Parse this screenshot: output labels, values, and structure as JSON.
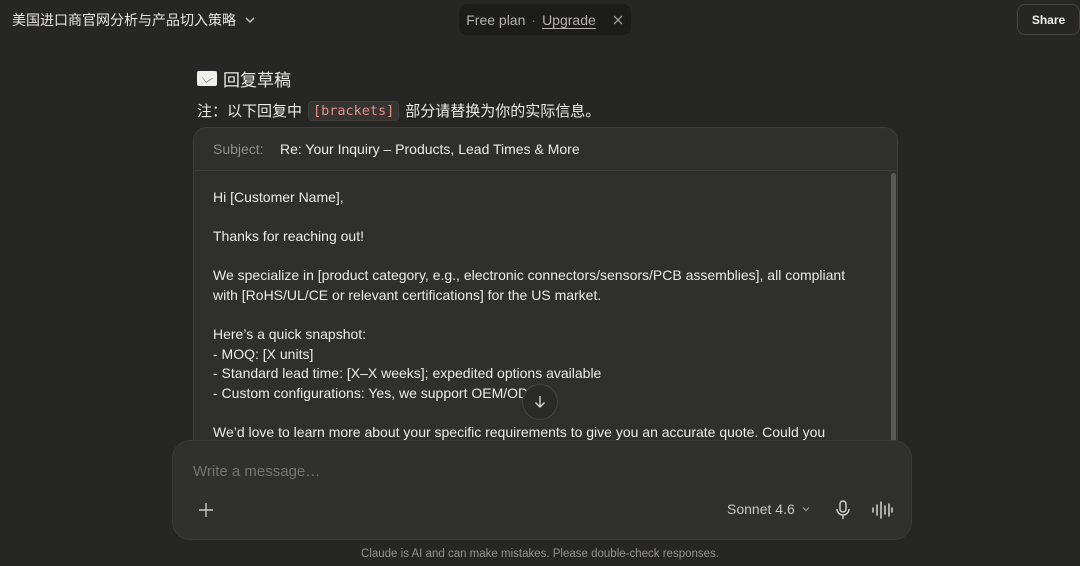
{
  "header": {
    "conversation_title": "美国进口商官网分析与产品切入策略",
    "plan_label": "Free plan",
    "plan_separator": "·",
    "upgrade_label": "Upgrade",
    "share_label": "Share"
  },
  "message": {
    "heading": "回复草稿",
    "note_prefix": "注：以下回复中",
    "note_code": "[brackets]",
    "note_suffix": "部分请替换为你的实际信息。"
  },
  "email": {
    "subject_label": "Subject:",
    "subject_value": "Re: Your Inquiry – Products, Lead Times & More",
    "body": "Hi [Customer Name],\n\nThanks for reaching out!\n\nWe specialize in [product category, e.g., electronic connectors/sensors/PCB assemblies], all compliant\nwith [RoHS/UL/CE or relevant certifications] for the US market.\n\nHere’s a quick snapshot:\n- MOQ: [X units]\n- Standard lead time: [X–X weeks]; expedited options available\n- Custom configurations: Yes, we support OEM/ODM\n\nWe’d love to learn more about your specific requirements to give you an accurate quote. Could you"
  },
  "composer": {
    "placeholder": "Write a message…",
    "model_label": "Sonnet 4.6"
  },
  "footer": {
    "disclaimer": "Claude is AI and can make mistakes. Please double-check responses."
  }
}
